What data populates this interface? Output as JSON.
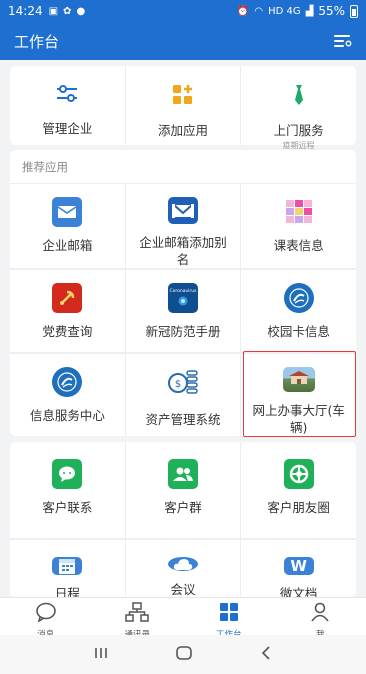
{
  "status_bar": {
    "time": "14:24",
    "network": "HD 4G",
    "battery": "55%"
  },
  "header": {
    "title": "工作台",
    "menu_icon": "list-settings-icon"
  },
  "quick_actions": [
    {
      "label": "管理企业",
      "icon": "sliders-icon",
      "color": "#1e6fcf"
    },
    {
      "label": "添加应用",
      "icon": "add-app-icon",
      "color": "#f2a71b"
    },
    {
      "label": "上门服务",
      "sub": "疫期远程",
      "icon": "tie-icon",
      "color": "#1fa866"
    }
  ],
  "recommended": {
    "title": "推荐应用",
    "apps": [
      {
        "label": "企业邮箱",
        "icon": "mail-icon",
        "color": "#3b82d6"
      },
      {
        "label": "企业邮箱添加别名",
        "icon": "mail-alias-icon",
        "color": "#1f5fb8"
      },
      {
        "label": "课表信息",
        "icon": "timetable-icon",
        "color": "#e94fa5"
      },
      {
        "label": "党费查询",
        "icon": "party-emblem-icon",
        "color": "#d42a1e"
      },
      {
        "label": "新冠防范手册",
        "icon": "coronavirus-icon",
        "color": "#0f4e8f",
        "icon_text": "Coronavirus"
      },
      {
        "label": "校园卡信息",
        "icon": "school-logo-icon",
        "color": "#1f6fbf"
      },
      {
        "label": "信息服务中心",
        "icon": "school-logo-icon",
        "color": "#1f6fbf"
      },
      {
        "label": "资产管理系统",
        "icon": "coins-icon",
        "color": "#2b6cb0"
      },
      {
        "label": "网上办事大厅(车辆)",
        "icon": "building-photo-icon",
        "color": "#6b8e5a"
      }
    ]
  },
  "customer_apps": [
    {
      "label": "客户联系",
      "icon": "chat-icon",
      "color": "#1fb15a"
    },
    {
      "label": "客户群",
      "icon": "group-icon",
      "color": "#1fb15a"
    },
    {
      "label": "客户朋友圈",
      "icon": "moments-icon",
      "color": "#1fb15a"
    },
    {
      "label": "日程",
      "icon": "calendar-icon",
      "color": "#3b82d6"
    },
    {
      "label": "会议",
      "icon": "cloud-icon",
      "color": "#3b82d6"
    },
    {
      "label": "微文档",
      "icon": "doc-icon",
      "color": "#3b82d6",
      "icon_text": "W"
    }
  ],
  "tabbar": [
    {
      "label": "消息",
      "icon": "message-icon",
      "active": false
    },
    {
      "label": "通讯录",
      "icon": "contacts-icon",
      "active": false
    },
    {
      "label": "工作台",
      "icon": "workbench-icon",
      "active": true
    },
    {
      "label": "我",
      "icon": "profile-icon",
      "active": false
    }
  ],
  "colors": {
    "accent": "#1e6fcf",
    "highlight": "#e23b3b",
    "background": "#f2f3f5"
  }
}
